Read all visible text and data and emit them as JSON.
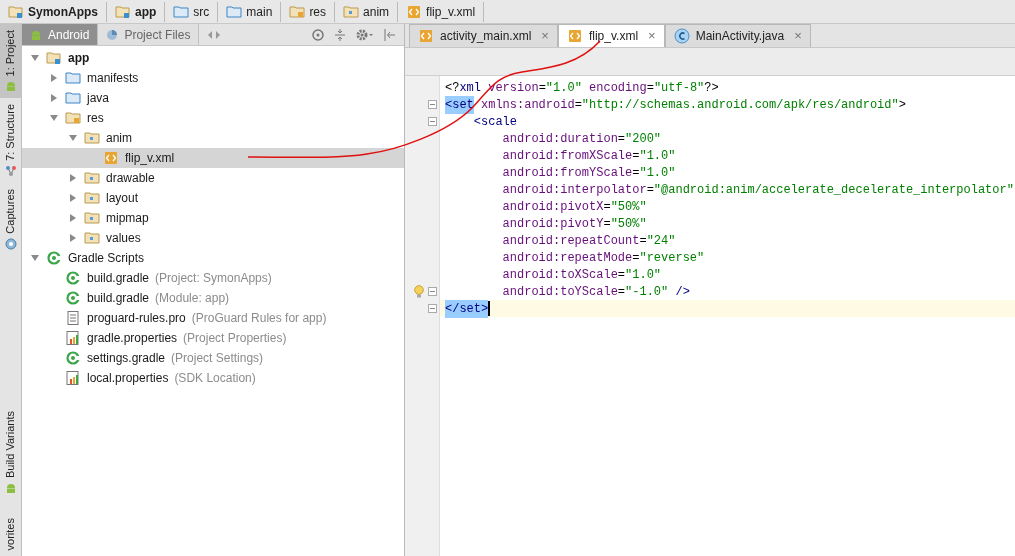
{
  "breadcrumbs": [
    {
      "label": "SymonApps",
      "bold": true,
      "kind": "module"
    },
    {
      "label": "app",
      "bold": true,
      "kind": "module"
    },
    {
      "label": "src",
      "bold": false,
      "kind": "folder"
    },
    {
      "label": "main",
      "bold": false,
      "kind": "folder"
    },
    {
      "label": "res",
      "bold": false,
      "kind": "res"
    },
    {
      "label": "anim",
      "bold": false,
      "kind": "package"
    },
    {
      "label": "flip_v.xml",
      "bold": false,
      "kind": "xml"
    }
  ],
  "side_tabs": [
    {
      "label": "1: Project",
      "selected": true,
      "kind": "android"
    },
    {
      "label": "7: Structure",
      "selected": false,
      "kind": "structure"
    },
    {
      "label": "Captures",
      "selected": false,
      "kind": "camera"
    },
    {
      "label": "Build Variants",
      "selected": false,
      "kind": "android"
    },
    {
      "label": "vorites",
      "selected": false,
      "kind": "none"
    }
  ],
  "project_panel": {
    "views": [
      {
        "label": "Android",
        "selected": true
      },
      {
        "label": "Project Files",
        "selected": false
      }
    ],
    "tree": [
      {
        "name": "app",
        "bold": true,
        "kind": "module",
        "expanded": true,
        "selected": false,
        "children": [
          {
            "name": "manifests",
            "bold": false,
            "kind": "folder",
            "expanded": false,
            "selected": false
          },
          {
            "name": "java",
            "bold": false,
            "kind": "folder",
            "expanded": false,
            "selected": false
          },
          {
            "name": "res",
            "bold": false,
            "kind": "res",
            "expanded": true,
            "selected": false,
            "children": [
              {
                "name": "anim",
                "bold": false,
                "kind": "package",
                "expanded": true,
                "selected": false,
                "children": [
                  {
                    "name": "flip_v.xml",
                    "bold": false,
                    "kind": "xml",
                    "selected": true
                  }
                ]
              },
              {
                "name": "drawable",
                "bold": false,
                "kind": "package",
                "expanded": false,
                "selected": false
              },
              {
                "name": "layout",
                "bold": false,
                "kind": "package",
                "expanded": false,
                "selected": false
              },
              {
                "name": "mipmap",
                "bold": false,
                "kind": "package",
                "expanded": false,
                "selected": false
              },
              {
                "name": "values",
                "bold": false,
                "kind": "package",
                "expanded": false,
                "selected": false
              }
            ]
          }
        ]
      },
      {
        "name": "Gradle Scripts",
        "bold": false,
        "kind": "gradle",
        "expanded": true,
        "selected": false,
        "children": [
          {
            "name": "build.gradle",
            "bold": false,
            "hint": "(Project: SymonApps)",
            "kind": "gradle",
            "selected": false
          },
          {
            "name": "build.gradle",
            "bold": false,
            "hint": "(Module: app)",
            "kind": "gradle",
            "selected": false
          },
          {
            "name": "proguard-rules.pro",
            "bold": false,
            "hint": "(ProGuard Rules for app)",
            "kind": "text",
            "selected": false
          },
          {
            "name": "gradle.properties",
            "bold": false,
            "hint": "(Project Properties)",
            "kind": "props",
            "selected": false
          },
          {
            "name": "settings.gradle",
            "bold": false,
            "hint": "(Project Settings)",
            "kind": "gradle",
            "selected": false
          },
          {
            "name": "local.properties",
            "bold": false,
            "hint": "(SDK Location)",
            "kind": "props",
            "selected": false
          }
        ]
      }
    ]
  },
  "editor_tabs": [
    {
      "label": "activity_main.xml",
      "kind": "xml",
      "selected": false,
      "close": "×"
    },
    {
      "label": "flip_v.xml",
      "kind": "xml",
      "selected": true,
      "close": "×"
    },
    {
      "label": "MainActivity.java",
      "kind": "class",
      "selected": false,
      "close": "×"
    }
  ],
  "code": [
    {
      "current": false,
      "tokens": [
        {
          "kind": "punct",
          "text": "<?"
        },
        {
          "kind": "tag",
          "text": "xml "
        },
        {
          "kind": "attr",
          "text": "version"
        },
        {
          "kind": "punct",
          "text": "="
        },
        {
          "kind": "value",
          "text": "\"1.0\" "
        },
        {
          "kind": "attr",
          "text": "encoding"
        },
        {
          "kind": "punct",
          "text": "="
        },
        {
          "kind": "value",
          "text": "\"utf-8\""
        },
        {
          "kind": "punct",
          "text": "?>"
        }
      ]
    },
    {
      "current": false,
      "gutter": [
        {
          "kind": "fold"
        }
      ],
      "tokens": [
        {
          "kind": "match",
          "text": "<set"
        },
        {
          "kind": "attr",
          "text": " xmlns:android"
        },
        {
          "kind": "punct",
          "text": "="
        },
        {
          "kind": "value",
          "text": "\"http://schemas.android.com/apk/res/android\""
        },
        {
          "kind": "punct",
          "text": ">"
        }
      ]
    },
    {
      "current": false,
      "gutter": [
        {
          "kind": "fold"
        }
      ],
      "tokens": [
        {
          "kind": "tag",
          "text": "    <scale"
        }
      ]
    },
    {
      "current": false,
      "tokens": [
        {
          "kind": "attr",
          "text": "        android:duration"
        },
        {
          "kind": "punct",
          "text": "="
        },
        {
          "kind": "value",
          "text": "\"200\""
        }
      ]
    },
    {
      "current": false,
      "tokens": [
        {
          "kind": "attr",
          "text": "        android:fromXScale"
        },
        {
          "kind": "punct",
          "text": "="
        },
        {
          "kind": "value",
          "text": "\"1.0\""
        }
      ]
    },
    {
      "current": false,
      "tokens": [
        {
          "kind": "attr",
          "text": "        android:fromYScale"
        },
        {
          "kind": "punct",
          "text": "="
        },
        {
          "kind": "value",
          "text": "\"1.0\""
        }
      ]
    },
    {
      "current": false,
      "tokens": [
        {
          "kind": "attr",
          "text": "        android:interpolator"
        },
        {
          "kind": "punct",
          "text": "="
        },
        {
          "kind": "value",
          "text": "\"@android:anim/accelerate_decelerate_interpolator\""
        }
      ]
    },
    {
      "current": false,
      "tokens": [
        {
          "kind": "attr",
          "text": "        android:pivotX"
        },
        {
          "kind": "punct",
          "text": "="
        },
        {
          "kind": "value",
          "text": "\"50%\""
        }
      ]
    },
    {
      "current": false,
      "tokens": [
        {
          "kind": "attr",
          "text": "        android:pivotY"
        },
        {
          "kind": "punct",
          "text": "="
        },
        {
          "kind": "value",
          "text": "\"50%\""
        }
      ]
    },
    {
      "current": false,
      "tokens": [
        {
          "kind": "attr",
          "text": "        android:repeatCount"
        },
        {
          "kind": "punct",
          "text": "="
        },
        {
          "kind": "value",
          "text": "\"24\""
        }
      ]
    },
    {
      "current": false,
      "tokens": [
        {
          "kind": "attr",
          "text": "        android:repeatMode"
        },
        {
          "kind": "punct",
          "text": "="
        },
        {
          "kind": "value",
          "text": "\"reverse\""
        }
      ]
    },
    {
      "current": false,
      "tokens": [
        {
          "kind": "attr",
          "text": "        android:toXScale"
        },
        {
          "kind": "punct",
          "text": "="
        },
        {
          "kind": "value",
          "text": "\"1.0\""
        }
      ]
    },
    {
      "current": false,
      "gutter": [
        {
          "kind": "bulb"
        },
        {
          "kind": "fold"
        }
      ],
      "tokens": [
        {
          "kind": "attr",
          "text": "        android:toYScale"
        },
        {
          "kind": "punct",
          "text": "="
        },
        {
          "kind": "value",
          "text": "\"-1.0\""
        },
        {
          "kind": "tag",
          "text": " />"
        }
      ]
    },
    {
      "current": true,
      "gutter": [
        {
          "kind": "fold"
        }
      ],
      "tokens": [
        {
          "kind": "match",
          "text": "</set>"
        }
      ]
    }
  ]
}
